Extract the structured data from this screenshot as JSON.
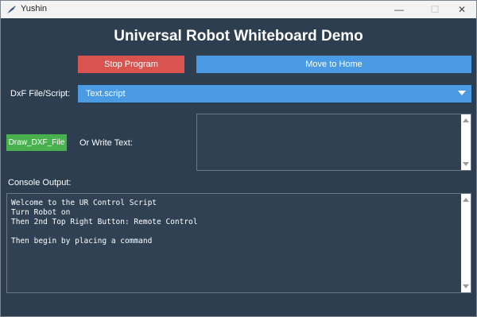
{
  "window": {
    "title": "Yushin",
    "controls": {
      "minimize": "—",
      "maximize": "☐",
      "close": "✕"
    }
  },
  "header": {
    "title": "Universal Robot Whiteboard Demo"
  },
  "buttons": {
    "stop_label": "Stop Program",
    "home_label": "Move to Home",
    "draw_label": "Draw_DXF_File"
  },
  "file_select": {
    "label": "DxF File/Script:",
    "selected": "Text.script"
  },
  "text_input": {
    "label": "Or Write Text:",
    "value": ""
  },
  "console": {
    "label": "Console Output:",
    "text": "Welcome to the UR Control Script\nTurn Robot on\nThen 2nd Top Right Button: Remote Control\n\nThen begin by placing a command"
  },
  "colors": {
    "background": "#2c3e50",
    "stop": "#d9534f",
    "primary": "#4a9be3",
    "success": "#48b04d"
  }
}
